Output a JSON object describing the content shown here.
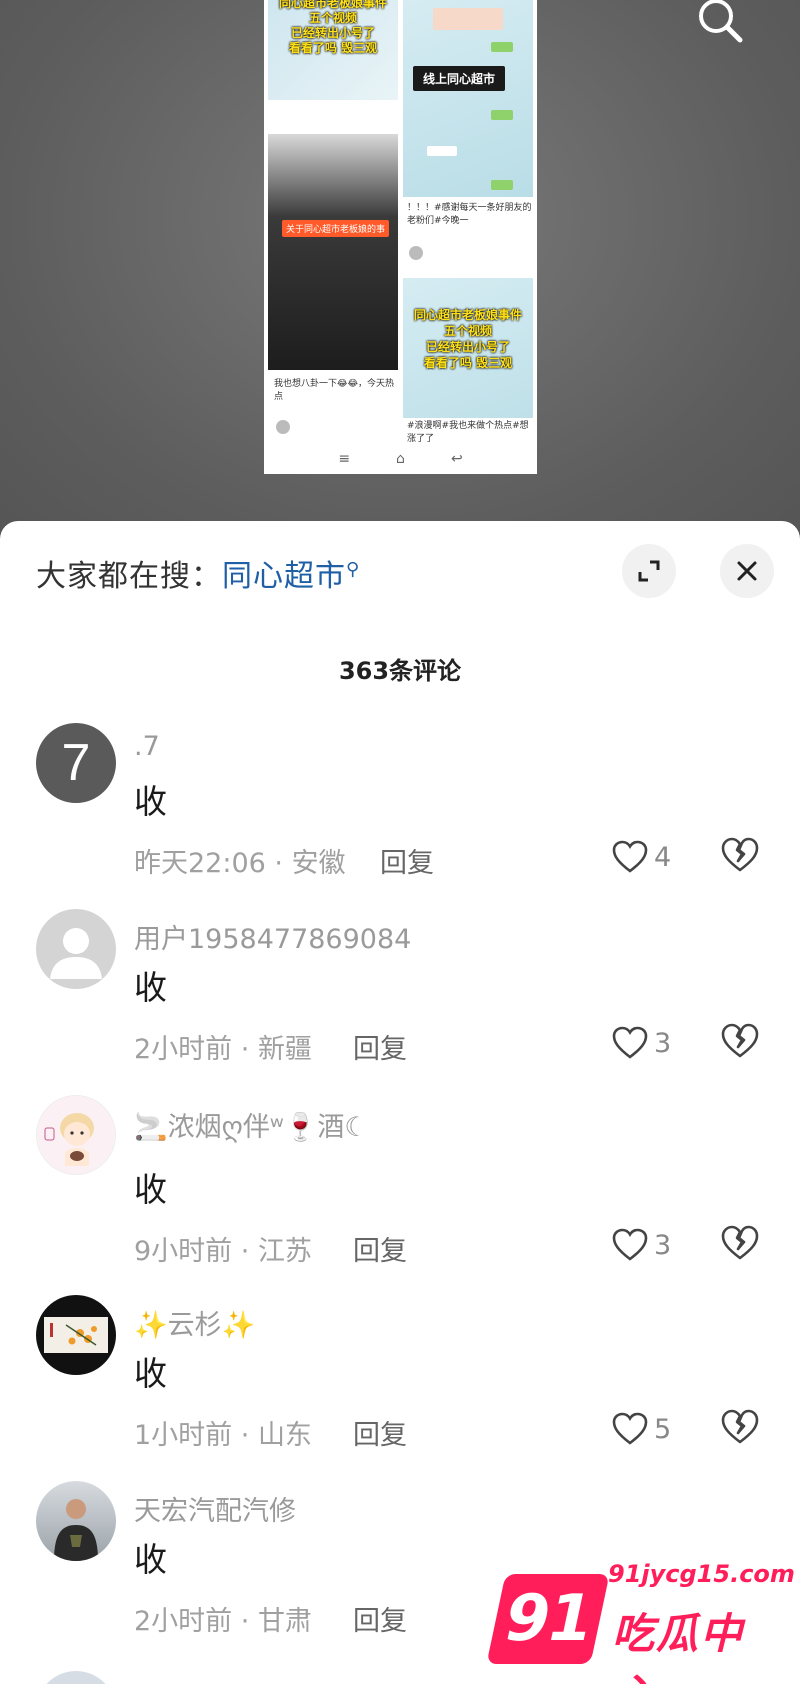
{
  "video_preview": {
    "tile1_caption_lines": [
      "同心超市老板娘事件",
      "五个视频",
      "已经转出小号了",
      "看看了吗 毁三观"
    ],
    "tile2_badge": "线上同心超市",
    "tile3_tag": "关于同心超市老板娘的事",
    "tile3_caption": "我也想八卦一下😂😂，今天热点",
    "tile4_caption_lines": [
      "同心超市老板娘事件",
      "五个视频",
      "已经转出小号了",
      "看看了吗 毁三观"
    ],
    "tile2_caption": "！！！#感谢每天一条好朋友的老粉们#今晚一",
    "tile4_caption": "#浪漫啊#我也来做个热点#想涨了了"
  },
  "sheet": {
    "hot_search_label": "大家都在搜：",
    "hot_search_keyword": "同心超市",
    "comment_count": "363条评论"
  },
  "comments": [
    {
      "name": ".7",
      "text": "收",
      "time": "昨天22:06",
      "location": "安徽",
      "reply": "回复",
      "likes": "4",
      "avatar_char": "7"
    },
    {
      "name": "用户1958477869084",
      "text": "收",
      "time": "2小时前",
      "location": "新疆",
      "reply": "回复",
      "likes": "3"
    },
    {
      "name": "🚬浓烟ღ伴ʷ🍷酒☾",
      "text": "收",
      "time": "9小时前",
      "location": "江苏",
      "reply": "回复",
      "likes": "3"
    },
    {
      "name": "✨云杉✨",
      "text": "收",
      "time": "1小时前",
      "location": "山东",
      "reply": "回复",
      "likes": "5"
    },
    {
      "name": "天宏汽配汽修",
      "text": "收",
      "time": "2小时前",
      "location": "甘肃",
      "reply": "回复",
      "likes": ""
    }
  ],
  "watermark": {
    "logo": "91",
    "url": "91jycg15.com",
    "name": "吃瓜中心"
  },
  "colors": {
    "keyword_blue": "#1f5fa5",
    "watermark_pink": "#ff1e5a"
  }
}
